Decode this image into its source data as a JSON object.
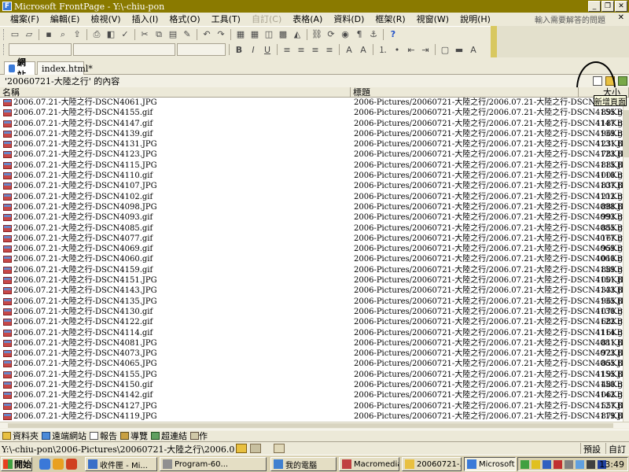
{
  "window": {
    "title": "Microsoft FrontPage - Y:\\-chiu-pon"
  },
  "menu": {
    "items": [
      {
        "label": "檔案(F)",
        "disabled": false
      },
      {
        "label": "編輯(E)",
        "disabled": false
      },
      {
        "label": "檢視(V)",
        "disabled": false
      },
      {
        "label": "插入(I)",
        "disabled": false
      },
      {
        "label": "格式(O)",
        "disabled": false
      },
      {
        "label": "工具(T)",
        "disabled": false
      },
      {
        "label": "自訂(C)",
        "disabled": true
      },
      {
        "label": "表格(A)",
        "disabled": false
      },
      {
        "label": "資料(D)",
        "disabled": false
      },
      {
        "label": "框架(R)",
        "disabled": false
      },
      {
        "label": "視窗(W)",
        "disabled": false
      },
      {
        "label": "說明(H)",
        "disabled": false
      }
    ],
    "ask_question": "輸入需要解答的問題"
  },
  "tabs": {
    "site": "網站",
    "index": "index.html*"
  },
  "folder_header": {
    "title": "'20060721-大陸之行' 的內容",
    "tooltip": "新增頁面"
  },
  "table": {
    "headers": {
      "name": "名稱",
      "title": "標題",
      "size": "大小"
    },
    "rows": [
      {
        "name": "2006.07.21-大陸之行-DSCN4061.JPG",
        "title": "2006-Pictures/20060721-大陸之行/2006.07.21-大陸之行-DSCN4061.JPG",
        "size": "89KB"
      },
      {
        "name": "2006.07.21-大陸之行-DSCN4155.gif",
        "title": "2006-Pictures/20060721-大陸之行/2006.07.21-大陸之行-DSCN4155.gif",
        "size": "89KB"
      },
      {
        "name": "2006.07.21-大陸之行-DSCN4147.gif",
        "title": "2006-Pictures/20060721-大陸之行/2006.07.21-大陸之行-DSCN4147.gif",
        "size": "118KB"
      },
      {
        "name": "2006.07.21-大陸之行-DSCN4139.gif",
        "title": "2006-Pictures/20060721-大陸之行/2006.07.21-大陸之行-DSCN4139.gif",
        "size": "96KB"
      },
      {
        "name": "2006.07.21-大陸之行-DSCN4131.JPG",
        "title": "2006-Pictures/20060721-大陸之行/2006.07.21-大陸之行-DSCN4131.JPG",
        "size": "123KB"
      },
      {
        "name": "2006.07.21-大陸之行-DSCN4123.JPG",
        "title": "2006-Pictures/20060721-大陸之行/2006.07.21-大陸之行-DSCN4123.JPG",
        "size": "78KB"
      },
      {
        "name": "2006.07.21-大陸之行-DSCN4115.JPG",
        "title": "2006-Pictures/20060721-大陸之行/2006.07.21-大陸之行-DSCN4115.JPG",
        "size": "88KB"
      },
      {
        "name": "2006.07.21-大陸之行-DSCN4110.gif",
        "title": "2006-Pictures/20060721-大陸之行/2006.07.21-大陸之行-DSCN4110.gif",
        "size": "100KB"
      },
      {
        "name": "2006.07.21-大陸之行-DSCN4107.JPG",
        "title": "2006-Pictures/20060721-大陸之行/2006.07.21-大陸之行-DSCN4107.JPG",
        "size": "83KB"
      },
      {
        "name": "2006.07.21-大陸之行-DSCN4102.gif",
        "title": "2006-Pictures/20060721-大陸之行/2006.07.21-大陸之行-DSCN4102.gif",
        "size": "121KB"
      },
      {
        "name": "2006.07.21-大陸之行-DSCN4098.JPG",
        "title": "2006-Pictures/20060721-大陸之行/2006.07.21-大陸之行-DSCN4098.JPG",
        "size": "88KB"
      },
      {
        "name": "2006.07.21-大陸之行-DSCN4093.gif",
        "title": "2006-Pictures/20060721-大陸之行/2006.07.21-大陸之行-DSCN4093.gif",
        "size": "99KB"
      },
      {
        "name": "2006.07.21-大陸之行-DSCN4085.gif",
        "title": "2006-Pictures/20060721-大陸之行/2006.07.21-大陸之行-DSCN4085.gif",
        "size": "85KB"
      },
      {
        "name": "2006.07.21-大陸之行-DSCN4077.gif",
        "title": "2006-Pictures/20060721-大陸之行/2006.07.21-大陸之行-DSCN4077.gif",
        "size": "116KB"
      },
      {
        "name": "2006.07.21-大陸之行-DSCN4069.gif",
        "title": "2006-Pictures/20060721-大陸之行/2006.07.21-大陸之行-DSCN4069.gif",
        "size": "95KB"
      },
      {
        "name": "2006.07.21-大陸之行-DSCN4060.gif",
        "title": "2006-Pictures/20060721-大陸之行/2006.07.21-大陸之行-DSCN4060.gif",
        "size": "101KB"
      },
      {
        "name": "2006.07.21-大陸之行-DSCN4159.gif",
        "title": "2006-Pictures/20060721-大陸之行/2006.07.21-大陸之行-DSCN4159.gif",
        "size": "88KB"
      },
      {
        "name": "2006.07.21-大陸之行-DSCN4151.JPG",
        "title": "2006-Pictures/20060721-大陸之行/2006.07.21-大陸之行-DSCN4151.JPG",
        "size": "100KB"
      },
      {
        "name": "2006.07.21-大陸之行-DSCN4143.JPG",
        "title": "2006-Pictures/20060721-大陸之行/2006.07.21-大陸之行-DSCN4143.JPG",
        "size": "133KB"
      },
      {
        "name": "2006.07.21-大陸之行-DSCN4135.JPG",
        "title": "2006-Pictures/20060721-大陸之行/2006.07.21-大陸之行-DSCN4135.JPG",
        "size": "96KB"
      },
      {
        "name": "2006.07.21-大陸之行-DSCN4130.gif",
        "title": "2006-Pictures/20060721-大陸之行/2006.07.21-大陸之行-DSCN4130.gif",
        "size": "107KB"
      },
      {
        "name": "2006.07.21-大陸之行-DSCN4122.gif",
        "title": "2006-Pictures/20060721-大陸之行/2006.07.21-大陸之行-DSCN4122.gif",
        "size": "68KB"
      },
      {
        "name": "2006.07.21-大陸之行-DSCN4114.gif",
        "title": "2006-Pictures/20060721-大陸之行/2006.07.21-大陸之行-DSCN4114.gif",
        "size": "116KB"
      },
      {
        "name": "2006.07.21-大陸之行-DSCN4081.JPG",
        "title": "2006-Pictures/20060721-大陸之行/2006.07.21-大陸之行-DSCN4081.JPG",
        "size": "81KB"
      },
      {
        "name": "2006.07.21-大陸之行-DSCN4073.JPG",
        "title": "2006-Pictures/20060721-大陸之行/2006.07.21-大陸之行-DSCN4073.JPG",
        "size": "92KB"
      },
      {
        "name": "2006.07.21-大陸之行-DSCN4065.JPG",
        "title": "2006-Pictures/20060721-大陸之行/2006.07.21-大陸之行-DSCN4065.JPG",
        "size": "85KB"
      },
      {
        "name": "2006.07.21-大陸之行-DSCN4155.JPG",
        "title": "2006-Pictures/20060721-大陸之行/2006.07.21-大陸之行-DSCN4155.JPG",
        "size": "119KB"
      },
      {
        "name": "2006.07.21-大陸之行-DSCN4150.gif",
        "title": "2006-Pictures/20060721-大陸之行/2006.07.21-大陸之行-DSCN4150.gif",
        "size": "48KB"
      },
      {
        "name": "2006.07.21-大陸之行-DSCN4142.gif",
        "title": "2006-Pictures/20060721-大陸之行/2006.07.21-大陸之行-DSCN4142.gif",
        "size": "106KB"
      },
      {
        "name": "2006.07.21-大陸之行-DSCN4127.JPG",
        "title": "2006-Pictures/20060721-大陸之行/2006.07.21-大陸之行-DSCN4127.JPG",
        "size": "55KB"
      },
      {
        "name": "2006.07.21-大陸之行-DSCN4119.JPG",
        "title": "2006-Pictures/20060721-大陸之行/2006.07.21-大陸之行-DSCN4119.JPG",
        "size": "87KB"
      }
    ]
  },
  "views": [
    {
      "label": "資料夾",
      "icon": "folder-icon",
      "cls": "folder"
    },
    {
      "label": "遠端網站",
      "icon": "remote-site-icon",
      "cls": "remote"
    },
    {
      "label": "報告",
      "icon": "report-icon",
      "cls": "report"
    },
    {
      "label": "導覽",
      "icon": "navigation-icon",
      "cls": "nav"
    },
    {
      "label": "超連結",
      "icon": "hyperlink-icon",
      "cls": "link"
    },
    {
      "label": "工作",
      "icon": "task-icon",
      "cls": "task"
    }
  ],
  "status": {
    "path": "Y:\\-chiu-pon\\2006-Pictures\\20060721-大陸之行\\2006.07.21-大陸之行-DSCN",
    "preset": "預設",
    "custom": "自訂"
  },
  "taskbar": {
    "start": "開始",
    "tasks": [
      {
        "label": "收件匣 - Mi...",
        "icon": "outlook-icon",
        "active": false
      },
      {
        "label": "Program-60...",
        "icon": "program-icon",
        "active": false
      },
      {
        "label": "我的電腦",
        "icon": "my-computer-icon",
        "active": false
      },
      {
        "label": "Macromedia...",
        "icon": "macromedia-icon",
        "active": false
      },
      {
        "label": "20060721-...",
        "icon": "folder-icon",
        "active": false
      },
      {
        "label": "Microsoft Fr...",
        "icon": "frontpage-icon",
        "active": true
      }
    ],
    "clock": "13:49"
  },
  "colors": {
    "titlebar": "#8A7A00",
    "tooltip_bg": "#FFFFE1"
  }
}
